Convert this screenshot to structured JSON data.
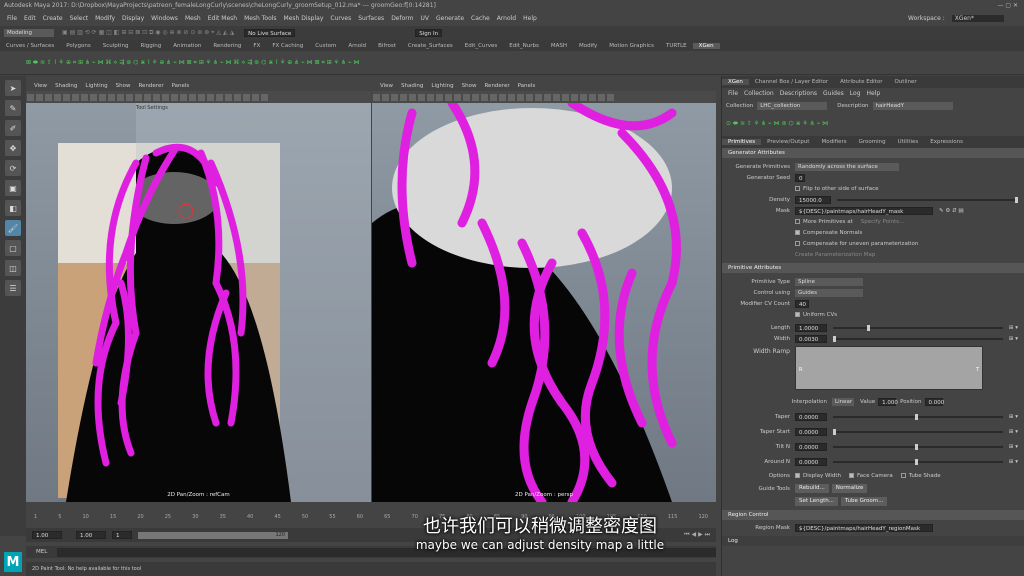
{
  "title_bar": {
    "title": "Autodesk Maya 2017: D:\\Dropbox\\MayaProjects\\patreon_femaleLongCurly\\scenes\\cheLongCurly_groomSetup_012.ma* --- groomGeo:f[0:14281]"
  },
  "menubar": {
    "items": [
      "File",
      "Edit",
      "Create",
      "Select",
      "Modify",
      "Display",
      "Windows",
      "Mesh",
      "Edit Mesh",
      "Mesh Tools",
      "Mesh Display",
      "Curves",
      "Surfaces",
      "Deform",
      "UV",
      "Generate",
      "Cache",
      "Arnold",
      "Help"
    ],
    "workspace_label": "Workspace :",
    "workspace_value": "XGen*"
  },
  "status_line": {
    "mode": "Modeling",
    "live_surface": "No Live Surface",
    "sign_in": "Sign In"
  },
  "shelf": {
    "tabs": [
      "Curves / Surfaces",
      "Polygons",
      "Sculpting",
      "Rigging",
      "Animation",
      "Rendering",
      "FX",
      "FX Caching",
      "Custom",
      "Arnold",
      "Bifrost",
      "Create_Surfaces",
      "Edit_Curves",
      "Edit_Nurbs",
      "MASH",
      "Modify",
      "Motion Graphics",
      "TURTLE",
      "XGen"
    ],
    "active_tab": "XGen"
  },
  "viewport_left": {
    "menus": [
      "View",
      "Shading",
      "Lighting",
      "Show",
      "Renderer",
      "Panels"
    ],
    "overlay": "Tool Settings",
    "camera_label": "2D Pan/Zoom : refCam"
  },
  "viewport_right": {
    "menus": [
      "View",
      "Shading",
      "Lighting",
      "Show",
      "Renderer",
      "Panels"
    ],
    "camera_label": "2D Pan/Zoom : persp"
  },
  "timeline": {
    "ticks": [
      "1",
      "5",
      "10",
      "15",
      "20",
      "25",
      "30",
      "35",
      "40",
      "45",
      "50",
      "55",
      "60",
      "65",
      "70",
      "75",
      "80",
      "85",
      "90",
      "95",
      "100",
      "105",
      "110",
      "115",
      "120"
    ],
    "range_start": "1.00",
    "range_start2": "1.00",
    "range_mid": "1",
    "range_end_marker": "120"
  },
  "mel": {
    "label": "MEL"
  },
  "help_line": {
    "text": "2D Paint Tool: No help available for this tool"
  },
  "subtitles": {
    "zh": "也许我们可以稍微调整密度图",
    "en": "maybe we can adjust density map a little"
  },
  "xgen_panel": {
    "tabs": [
      "XGen",
      "Channel Box / Layer Editor",
      "Attribute Editor",
      "Outliner"
    ],
    "menu": [
      "File",
      "Collection",
      "Descriptions",
      "Guides",
      "Log",
      "Help"
    ],
    "collection_label": "Collection",
    "collection_value": "LHC_collection",
    "description_label": "Description",
    "description_value": "hairHeadY",
    "sub_tabs": [
      "Primitives",
      "Preview/Output",
      "Modifiers",
      "Grooming",
      "Utilities",
      "Expressions"
    ],
    "generator_section": "Generator Attributes",
    "generate_primitives_label": "Generate Primitives",
    "generate_primitives_value": "Randomly across the surface",
    "generator_seed_label": "Generator Seed",
    "generator_seed_value": "0",
    "flip_label": "Flip to other side of surface",
    "density_label": "Density",
    "density_value": "15000.0",
    "mask_label": "Mask",
    "mask_value": "${DESC}/paintmaps/hairHeadY_mask",
    "more_primitives": "More Primitives at",
    "specify_points": "Specify Points...",
    "compensate_normals": "Compensate Normals",
    "compensate_uneven": "Compensate for uneven parameterization",
    "create_param_map": "Create Parameterization Map",
    "primitive_section": "Primitive Attributes",
    "primitive_type_label": "Primitive Type",
    "primitive_type_value": "Spline",
    "control_using_label": "Control using",
    "control_using_value": "Guides",
    "modifier_cv_label": "Modifier CV Count",
    "modifier_cv_value": "40",
    "uniform_cvs": "Uniform CVs",
    "length_label": "Length",
    "length_value": "1.0000",
    "width_label": "Width",
    "width_value": "0.0030",
    "width_ramp_label": "Width Ramp",
    "ramp_r": "R",
    "ramp_t": "T",
    "interpolation_label": "Interpolation",
    "interpolation_value": "Linear",
    "value_label": "Value",
    "value_value": "1.000",
    "position_label": "Position",
    "position_value": "0.000",
    "taper_label": "Taper",
    "taper_value": "0.0000",
    "taper_start_label": "Taper Start",
    "taper_start_value": "0.0000",
    "tilt_n_label": "Tilt N",
    "tilt_n_value": "0.0000",
    "around_n_label": "Around N",
    "around_n_value": "0.0000",
    "options_label": "Options",
    "display_width": "Display Width",
    "face_camera": "Face Camera",
    "tube_shade": "Tube Shade",
    "guide_tools_label": "Guide Tools",
    "rebuild_btn": "Rebuild...",
    "normalize_btn": "Normalize",
    "set_length_btn": "Set Length...",
    "tube_groom_btn": "Tube Groom...",
    "region_section": "Region Control",
    "region_mask_label": "Region Mask",
    "region_mask_value": "${DESC}/paintmaps/hairHeadY_regionMask",
    "log_section": "Log"
  },
  "colors": {
    "accent": "#5285a6",
    "hair": "#e020e0",
    "maya_logo": "#00a4b4"
  }
}
